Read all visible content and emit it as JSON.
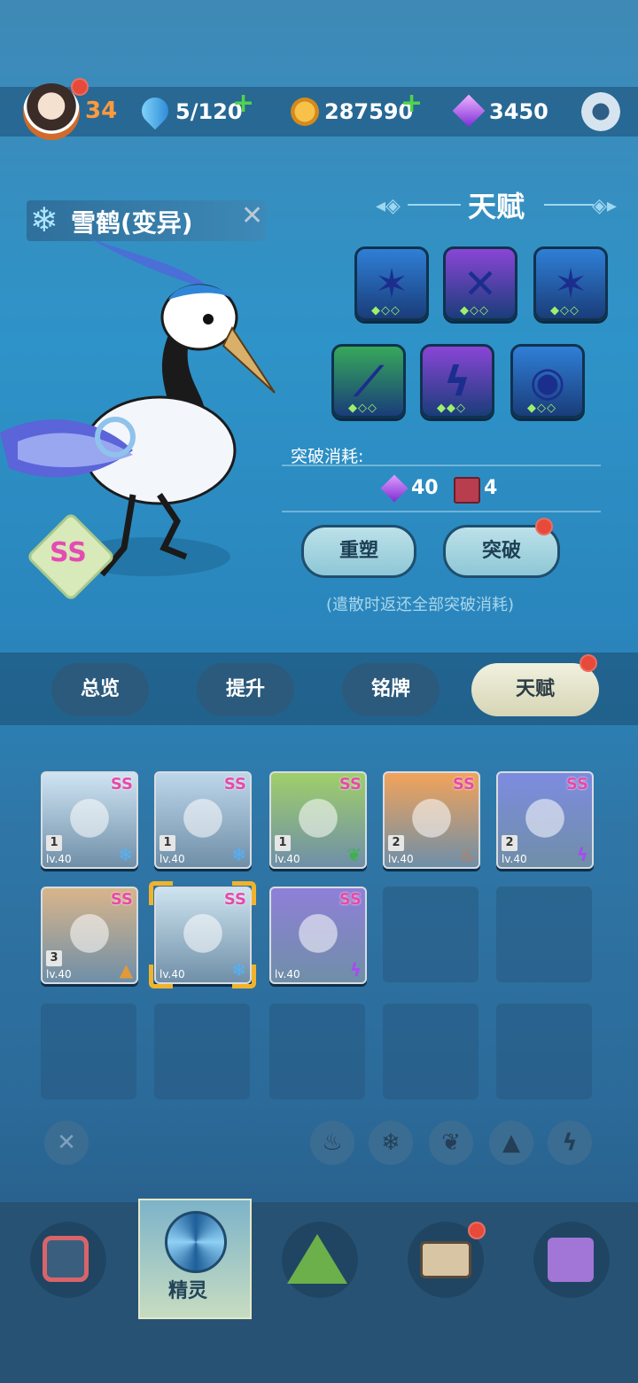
{
  "top_bar": {
    "player_level": "34",
    "stamina": "5/120",
    "coins": "287590",
    "gems": "3450",
    "plus_symbol": "+"
  },
  "spirit": {
    "name": "雪鹤(变异)",
    "grade": "SS",
    "element": "ice",
    "close_symbol": "✕"
  },
  "talent": {
    "title": "天赋",
    "slots": [
      {
        "icon": "ice-burst-icon",
        "color": "#2f7fd6",
        "glyph": "✶",
        "stars": "◆◇◇"
      },
      {
        "icon": "arcane-slash-icon",
        "color": "#8a45d6",
        "glyph": "✕",
        "stars": "◆◇◇"
      },
      {
        "icon": "ice-burst-icon",
        "color": "#2f7fd6",
        "glyph": "✶",
        "stars": "◆◇◇"
      },
      {
        "icon": "claw-slash-icon",
        "color": "#36a85a",
        "glyph": "⟋",
        "stars": "◆◇◇"
      },
      {
        "icon": "lightning-icon",
        "color": "#8a45d6",
        "glyph": "ϟ",
        "stars": "◆◆◇"
      },
      {
        "icon": "eye-icon",
        "color": "#2f7fd6",
        "glyph": "◉",
        "stars": "◆◇◇"
      }
    ],
    "breakthrough_cost_label": "突破消耗:",
    "cost_gem_amount": "40",
    "cost_book_amount": "4",
    "reshape_button": "重塑",
    "breakthrough_button": "突破",
    "note": "(遣散时返还全部突破消耗)"
  },
  "tabs": [
    {
      "label": "总览",
      "active": false
    },
    {
      "label": "提升",
      "active": false
    },
    {
      "label": "铭牌",
      "active": false
    },
    {
      "label": "天赋",
      "active": true
    }
  ],
  "spirit_cards": [
    {
      "grade": "SS",
      "level": "lv.40",
      "num": "1",
      "element": "ice",
      "elem_glyph": "❄",
      "elem_color": "#4fb3ff",
      "bg": "#cfe4f3"
    },
    {
      "grade": "SS",
      "level": "lv.40",
      "num": "1",
      "element": "ice",
      "elem_glyph": "❄",
      "elem_color": "#4fb3ff",
      "bg": "#bdd6ea"
    },
    {
      "grade": "SS",
      "level": "lv.40",
      "num": "1",
      "element": "grass",
      "elem_glyph": "❦",
      "elem_color": "#3bb24a",
      "bg": "#9fcf6a"
    },
    {
      "grade": "SS",
      "level": "lv.40",
      "num": "2",
      "element": "fire",
      "elem_glyph": "♨",
      "elem_color": "#f06a25",
      "bg": "#f2a35a"
    },
    {
      "grade": "SS",
      "level": "lv.40",
      "num": "2",
      "element": "thunder",
      "elem_glyph": "ϟ",
      "elem_color": "#a64cf0",
      "bg": "#7d8be0"
    },
    {
      "grade": "SS",
      "level": "lv.40",
      "num": "3",
      "element": "earth",
      "elem_glyph": "▲",
      "elem_color": "#e09a3a",
      "bg": "#d9b58a"
    },
    {
      "grade": "SS",
      "level": "lv.40",
      "num": "",
      "element": "ice",
      "elem_glyph": "❄",
      "elem_color": "#4fb3ff",
      "bg": "#cde3ef"
    },
    {
      "grade": "SS",
      "level": "lv.40",
      "num": "",
      "element": "thunder",
      "elem_glyph": "ϟ",
      "elem_color": "#a64cf0",
      "bg": "#8f7fd8"
    }
  ],
  "filters": [
    "fire-filter-icon",
    "ice-filter-icon",
    "grass-filter-icon",
    "earth-filter-icon",
    "thunder-filter-icon"
  ],
  "bottom_nav": {
    "active_label": "精灵"
  }
}
